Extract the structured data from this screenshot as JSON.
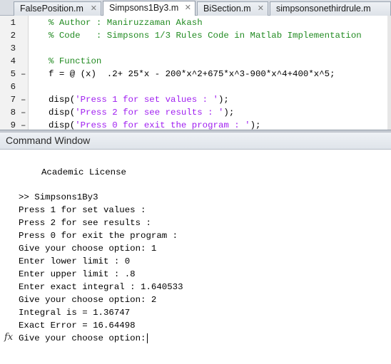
{
  "tabs": [
    {
      "label": "FalsePosition.m",
      "close": "✕"
    },
    {
      "label": "Simpsons1By3.m",
      "close": "✕"
    },
    {
      "label": "BiSection.m",
      "close": "✕"
    },
    {
      "label": "simpsonsonethirdrule.m",
      "close": "✕"
    }
  ],
  "active_tab": "Simpsons1By3.m",
  "editor": {
    "lines": [
      {
        "num": "1",
        "mark": "",
        "text": "% Author : Maniruzzaman Akash",
        "kind": "comment"
      },
      {
        "num": "2",
        "mark": "",
        "text": "% Code   : Simpsons 1/3 Rules Code in Matlab Implementation",
        "kind": "comment"
      },
      {
        "num": "3",
        "mark": "",
        "text": "",
        "kind": "plain"
      },
      {
        "num": "4",
        "mark": "",
        "text": "% Function",
        "kind": "comment"
      },
      {
        "num": "5",
        "mark": "–",
        "text": "f = @ (x)  .2+ 25*x - 200*x^2+675*x^3-900*x^4+400*x^5;",
        "kind": "plain"
      },
      {
        "num": "6",
        "mark": "",
        "text": "",
        "kind": "plain"
      },
      {
        "num": "7",
        "mark": "–",
        "pre": "disp(",
        "str": "'Press 1 for set values : '",
        "post": ");",
        "kind": "disp"
      },
      {
        "num": "8",
        "mark": "–",
        "pre": "disp(",
        "str": "'Press 2 for see results : '",
        "post": ");",
        "kind": "disp"
      },
      {
        "num": "9",
        "mark": "–",
        "pre": "disp(",
        "str": "'Press 0 for exit the program : '",
        "post": ");",
        "kind": "disp"
      }
    ]
  },
  "command_window": {
    "title": "Command Window",
    "license": "Academic License",
    "lines": [
      ">> Simpsons1By3",
      "Press 1 for set values :",
      "Press 2 for see results :",
      "Press 0 for exit the program :",
      "Give your choose option: 1",
      "Enter lower limit : 0",
      "Enter upper limit : .8",
      "Enter exact integral : 1.640533",
      "Give your choose option: 2",
      "Integral is = 1.36747",
      "Exact Error = 16.64498",
      "Give your choose option:"
    ],
    "prompt_icon": "fx"
  },
  "colors": {
    "comment": "#228b22",
    "string": "#a020f0",
    "tabbar": "#d9dde3"
  }
}
